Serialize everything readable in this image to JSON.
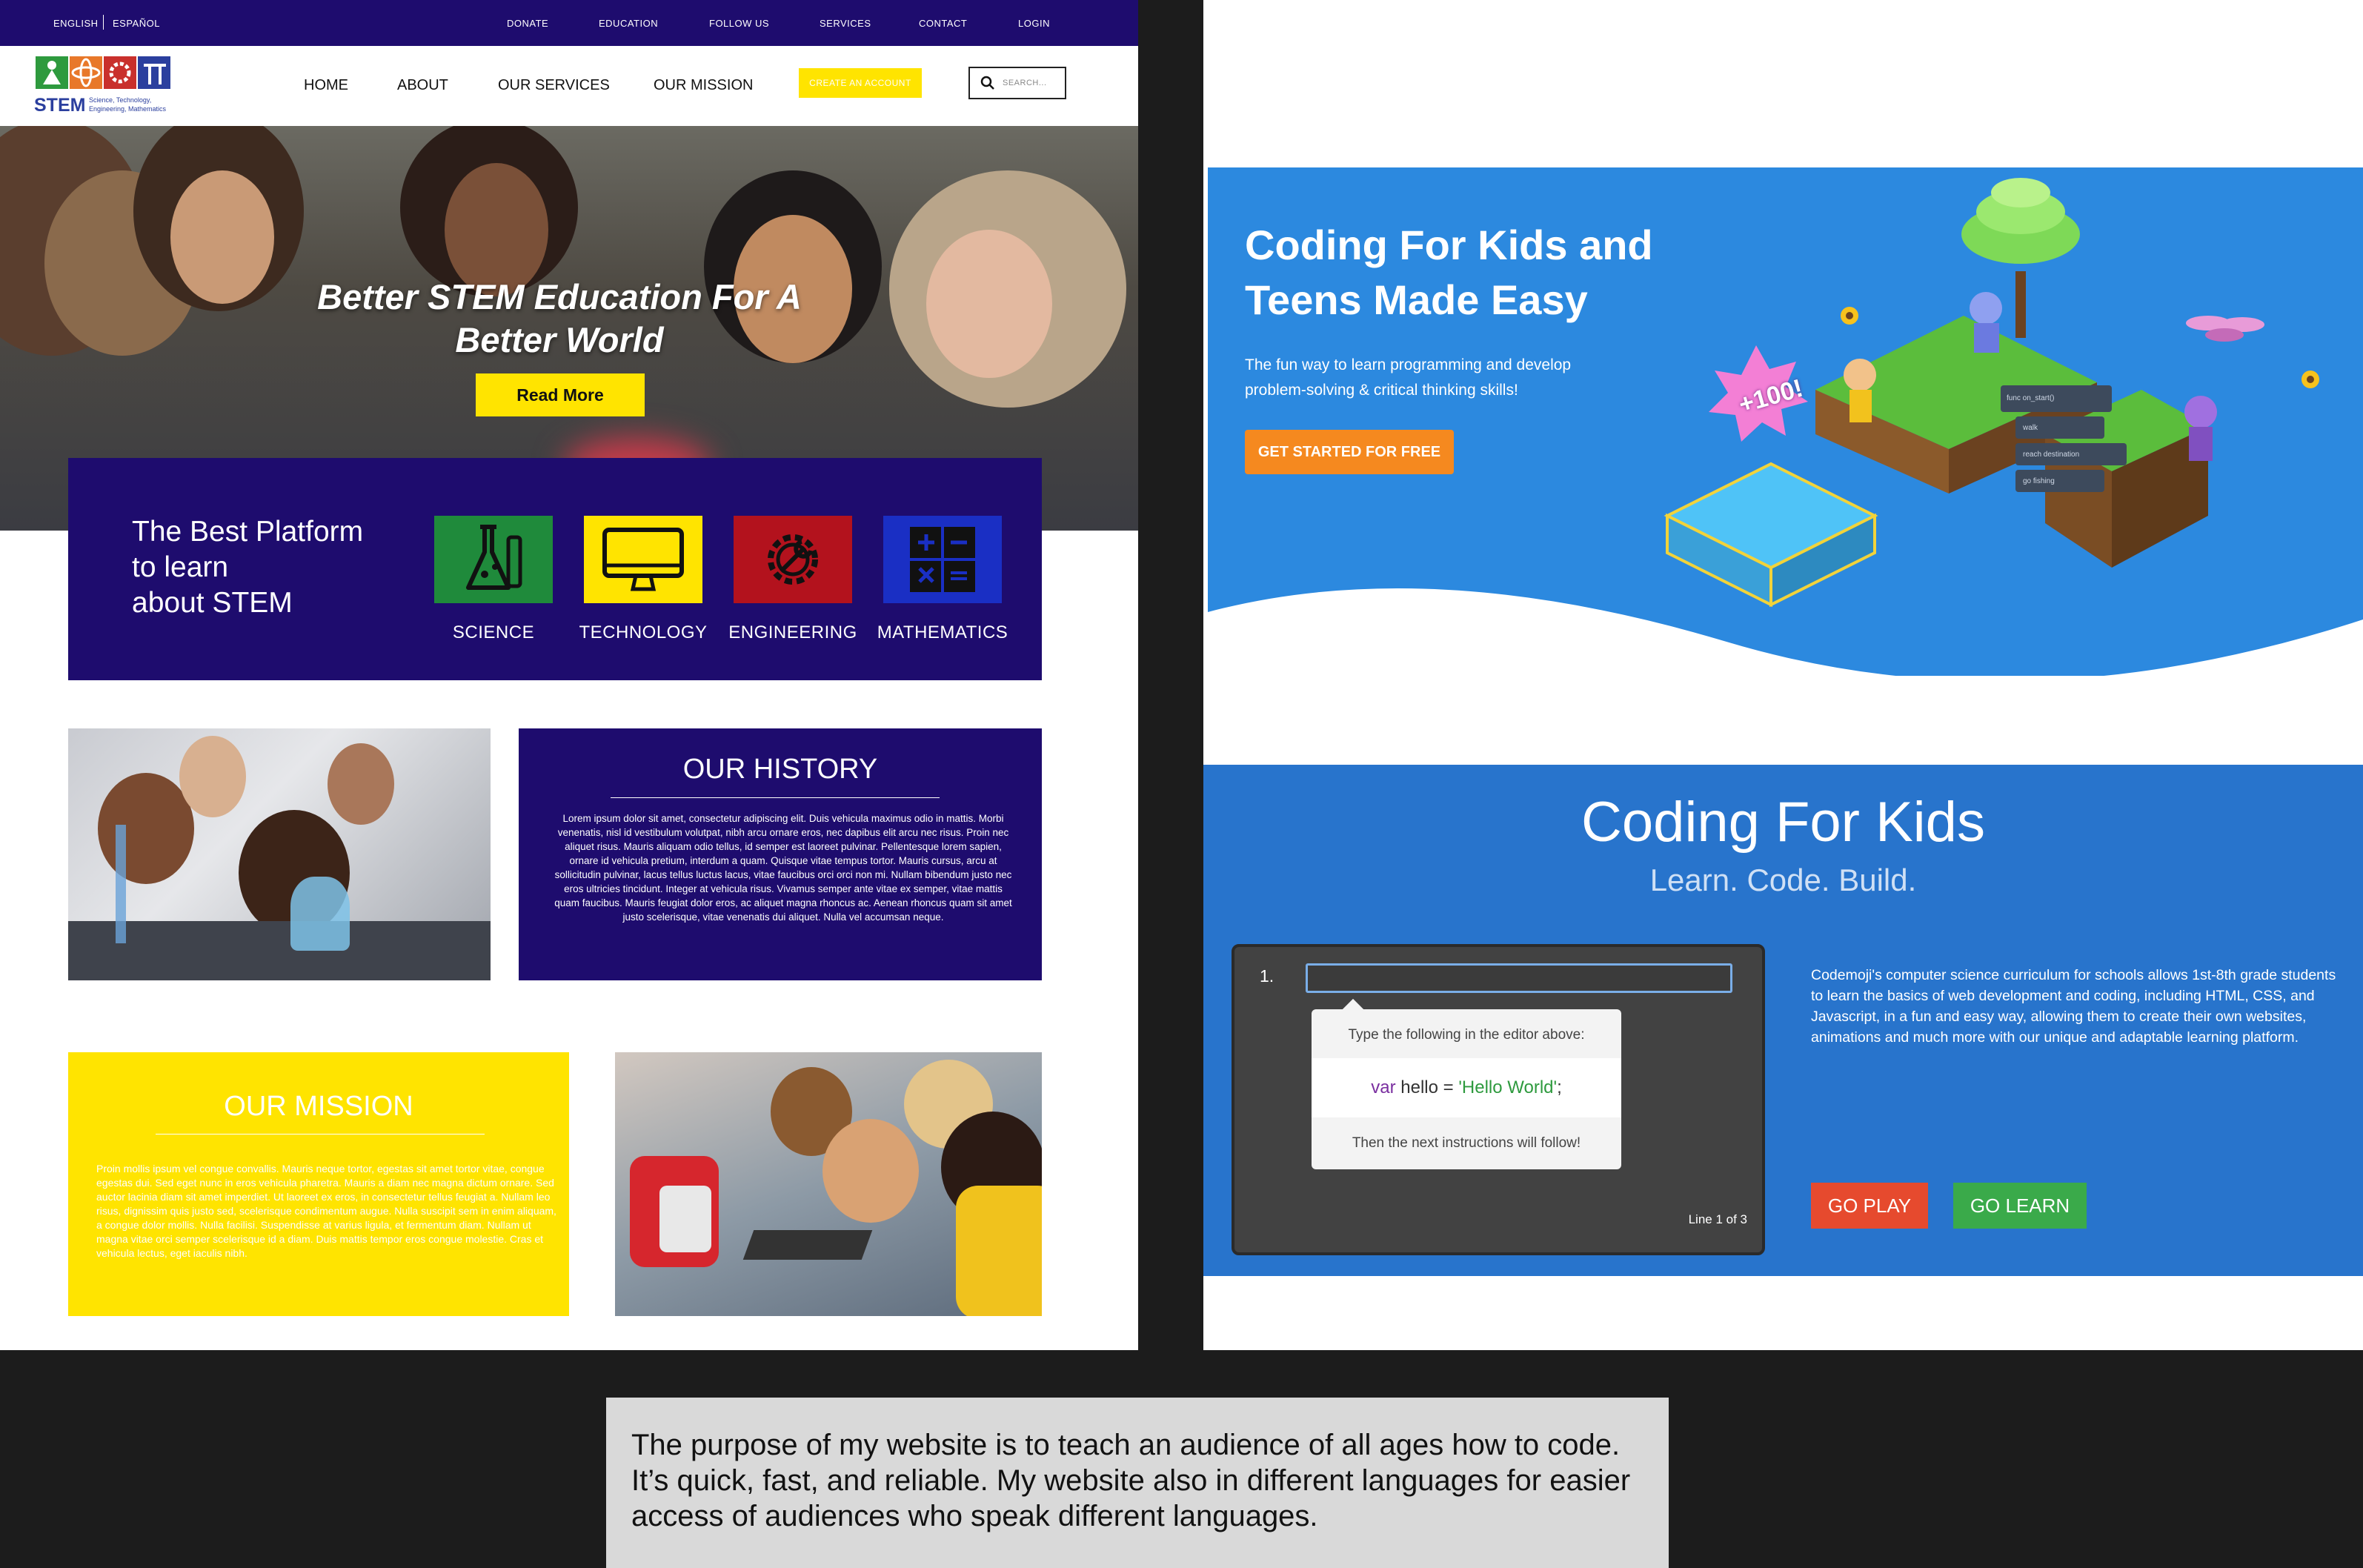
{
  "left": {
    "topbar": {
      "lang_english": "ENGLISH",
      "lang_spanish": "ESPAÑOL",
      "links": [
        "DONATE",
        "EDUCATION",
        "FOLLOW US",
        "SERVICES",
        "CONTACT",
        "LOGIN"
      ]
    },
    "logo": {
      "word": "STEM",
      "tagline_1": "Science, Technology,",
      "tagline_2": "Engineering, Mathematics"
    },
    "nav": {
      "items": [
        "HOME",
        "ABOUT",
        "OUR SERVICES",
        "OUR MISSION"
      ],
      "create_account": "CREATE AN ACCOUNT",
      "search_placeholder": "SEARCH..."
    },
    "hero": {
      "title_line1": "Better STEM Education For A",
      "title_line2": "Better World",
      "button": "Read More"
    },
    "platform": {
      "text_line1": "The Best Platform",
      "text_line2": "to learn",
      "text_line3": "about STEM",
      "categories": [
        {
          "label": "SCIENCE",
          "color": "#1f8a3b",
          "icon": "flask-icon"
        },
        {
          "label": "TECHNOLOGY",
          "color": "#ffe400",
          "icon": "monitor-icon"
        },
        {
          "label": "ENGINEERING",
          "color": "#b3121d",
          "icon": "gear-wrench-icon"
        },
        {
          "label": "MATHEMATICS",
          "color": "#1a2fc4",
          "icon": "math-symbols-icon"
        }
      ]
    },
    "history": {
      "title": "OUR HISTORY",
      "body": "Lorem ipsum dolor sit amet, consectetur adipiscing elit. Duis vehicula maximus odio in mattis. Morbi venenatis, nisl id vestibulum volutpat, nibh arcu ornare eros, nec dapibus elit arcu nec risus. Proin nec aliquet risus. Mauris aliquam odio tellus, id semper est laoreet pulvinar. Pellentesque lorem sapien, ornare id vehicula pretium, interdum a quam. Quisque vitae tempus tortor. Mauris cursus, arcu at sollicitudin pulvinar, lacus tellus luctus lacus, vitae faucibus orci orci non mi. Nullam bibendum justo nec eros ultricies tincidunt. Integer at vehicula risus. Vivamus semper ante vitae ex semper, vitae mattis quam faucibus. Mauris feugiat dolor eros, ac aliquet magna rhoncus ac. Aenean rhoncus quam sit amet justo scelerisque, vitae venenatis dui aliquet. Nulla vel accumsan neque."
    },
    "mission": {
      "title": "OUR MISSION",
      "body": "Proin mollis ipsum vel congue convallis. Mauris neque tortor, egestas sit amet tortor vitae, congue egestas dui. Sed eget nunc in eros vehicula pharetra. Mauris a diam nec magna dictum ornare. Sed auctor lacinia diam sit amet imperdiet. Ut laoreet ex eros, in consectetur tellus feugiat a. Nullam leo risus, dignissim quis justo sed, scelerisque condimentum augue. Nulla suscipit sem in enim aliquam, a congue dolor mollis. Nulla facilisi. Suspendisse at varius ligula, et fermentum diam. Nullam ut magna vitae orci semper scelerisque id a diam. Duis mattis tempor eros congue molestie. Cras et vehicula lectus, eget iaculis nibh."
    }
  },
  "right": {
    "banner": {
      "title_line1": "Coding For Kids and",
      "title_line2": "Teens Made Easy",
      "subtitle_line1": "The fun way to learn programming and develop",
      "subtitle_line2": "problem-solving & critical thinking skills!",
      "cta": "GET STARTED FOR FREE",
      "badge": "+100!",
      "code_blocks": [
        "func on_start()",
        "walk",
        "reach destination",
        "go fishing"
      ]
    },
    "coding": {
      "title": "Coding For Kids",
      "subtitle": "Learn. Code. Build.",
      "editor": {
        "line_number": "1.",
        "tip_intro": "Type the following in the editor above:",
        "code_keyword": "var",
        "code_name": " hello = ",
        "code_string": "'Hello World'",
        "code_end": ";",
        "tip_outro": "Then the next instructions will follow!",
        "line_status": "Line 1 of 3"
      },
      "description": "Codemoji's computer science curriculum for schools allows 1st-8th grade students to learn the basics of web development and coding, including HTML, CSS, and Javascript, in a fun and easy way, allowing them to create their own websites, animations and much more with our unique and adaptable learning platform.",
      "go_play": "GO PLAY",
      "go_learn": "GO LEARN"
    }
  },
  "caption": "The purpose of my website is to teach an audience of all ages how to code. It’s quick, fast, and reliable. My website also in different languages for easier access of audiences who speak different languages."
}
